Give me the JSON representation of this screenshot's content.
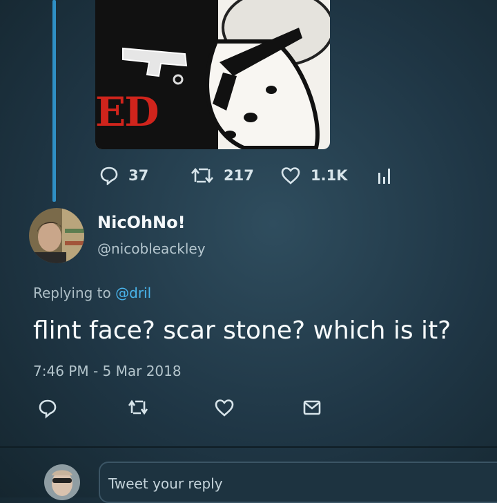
{
  "parent_tweet": {
    "media": {
      "visible_text": "ED"
    },
    "actions": {
      "reply_icon": "speech-bubble-icon",
      "reply_count": "37",
      "retweet_icon": "retweet-icon",
      "retweet_count": "217",
      "like_icon": "heart-icon",
      "like_count": "1.1K",
      "analytics_icon": "bar-chart-icon"
    }
  },
  "reply_tweet": {
    "display_name": "NicOhNo!",
    "handle": "@nicobleackley",
    "replying_to_prefix": "Replying to",
    "replying_to_handle": "@dril",
    "text": "flint face? scar stone? which is it?",
    "timestamp": "7:46 PM - 5 Mar 2018",
    "action_icons": [
      "reply-icon",
      "retweet-icon",
      "heart-icon",
      "mail-icon"
    ]
  },
  "composer": {
    "placeholder": "Tweet your reply"
  },
  "colors": {
    "background": "#1f3645",
    "thread_line": "#2f8fc4",
    "mention": "#49b3ea",
    "media_red": "#d0241c"
  }
}
